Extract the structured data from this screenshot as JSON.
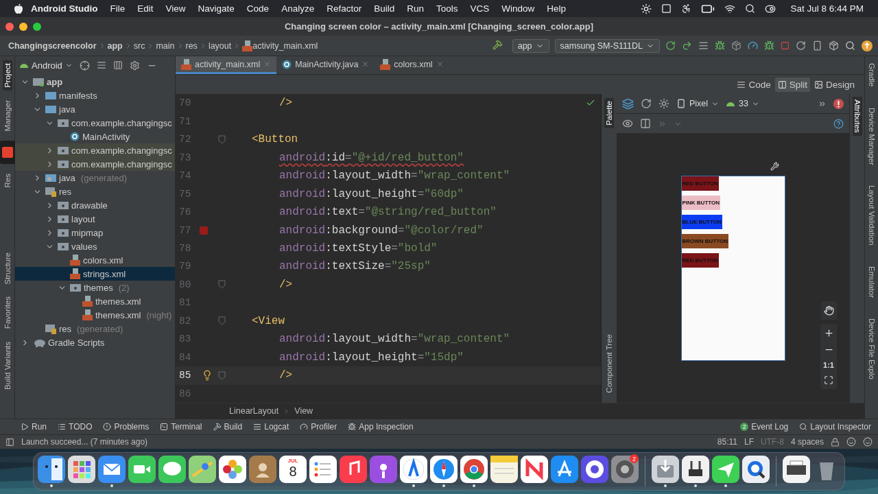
{
  "menu_bar": {
    "app": "Android Studio",
    "menus": [
      "File",
      "Edit",
      "View",
      "Navigate",
      "Code",
      "Analyze",
      "Refactor",
      "Build",
      "Run",
      "Tools",
      "VCS",
      "Window",
      "Help"
    ],
    "clock": "Sat Jul 8  6:44 PM"
  },
  "window": {
    "title": "Changing screen color – activity_main.xml [Changing_screen_color.app]"
  },
  "nav_bar": {
    "breadcrumbs": [
      "Changingscreencolor",
      "app",
      "src",
      "main",
      "res",
      "layout",
      "activity_main.xml"
    ],
    "run_config": "app",
    "device": "samsung SM-S111DL"
  },
  "left_strip": [
    {
      "label": "Project",
      "selected": true
    },
    {
      "label": "Manager",
      "selected": false
    },
    {
      "label": "Res",
      "selected": false
    },
    {
      "label": "Structure",
      "selected": false
    },
    {
      "label": "Favorites",
      "selected": false
    },
    {
      "label": "Build Variants",
      "selected": false
    }
  ],
  "right_strip": [
    {
      "label": "Gradle",
      "selected": false
    },
    {
      "label": "Device Manager",
      "selected": false
    },
    {
      "label": "Layout Validation",
      "selected": false
    },
    {
      "label": "Emulator",
      "selected": false
    },
    {
      "label": "Device File Explo",
      "selected": false
    }
  ],
  "project_panel": {
    "view": "Android",
    "tree": [
      {
        "label": "app",
        "kind": "module",
        "expanded": true,
        "selected": false,
        "children": [
          {
            "label": "manifests",
            "kind": "folder",
            "expanded": false,
            "selected": false
          },
          {
            "label": "java",
            "kind": "folder",
            "expanded": true,
            "selected": false,
            "children": [
              {
                "label": "com.example.changingsc",
                "kind": "package",
                "expanded": true,
                "selected": false,
                "children": [
                  {
                    "label": "MainActivity",
                    "kind": "class",
                    "selected": false
                  }
                ]
              },
              {
                "label": "com.example.changingsc",
                "kind": "test-package",
                "expanded": false,
                "selected": false
              },
              {
                "label": "com.example.changingsc",
                "kind": "test-package",
                "expanded": false,
                "selected": false
              }
            ]
          },
          {
            "label": "java",
            "note": "(generated)",
            "kind": "generated",
            "expanded": false,
            "selected": false
          },
          {
            "label": "res",
            "kind": "resources",
            "expanded": true,
            "selected": false,
            "children": [
              {
                "label": "drawable",
                "kind": "package",
                "expanded": false,
                "selected": false
              },
              {
                "label": "layout",
                "kind": "package",
                "expanded": false,
                "selected": false
              },
              {
                "label": "mipmap",
                "kind": "package",
                "expanded": false,
                "selected": false
              },
              {
                "label": "values",
                "kind": "package",
                "expanded": true,
                "selected": false,
                "children": [
                  {
                    "label": "colors.xml",
                    "kind": "xml",
                    "selected": false
                  },
                  {
                    "label": "strings.xml",
                    "kind": "xml",
                    "selected": true
                  },
                  {
                    "label": "themes",
                    "note": "(2)",
                    "kind": "package",
                    "expanded": true,
                    "selected": false,
                    "children": [
                      {
                        "label": "themes.xml",
                        "kind": "xml",
                        "selected": false
                      },
                      {
                        "label": "themes.xml",
                        "note": "(night)",
                        "kind": "xml",
                        "selected": false
                      }
                    ]
                  }
                ]
              }
            ]
          },
          {
            "label": "res",
            "note": "(generated)",
            "kind": "resources",
            "selected": false
          }
        ]
      },
      {
        "label": "Gradle Scripts",
        "kind": "gradle",
        "expanded": false,
        "selected": false
      }
    ]
  },
  "editor_tabs": [
    {
      "label": "activity_main.xml",
      "kind": "xml",
      "selected": true
    },
    {
      "label": "MainActivity.java",
      "kind": "java",
      "selected": false
    },
    {
      "label": "colors.xml",
      "kind": "xml",
      "selected": false
    }
  ],
  "view_modes": [
    {
      "label": "Code",
      "selected": false
    },
    {
      "label": "Split",
      "selected": true
    },
    {
      "label": "Design",
      "selected": false
    }
  ],
  "code": [
    {
      "number": "70",
      "kind": "close",
      "tokens": [
        {
          "kind": "tag",
          "text": "/>"
        }
      ]
    },
    {
      "number": "71",
      "kind": "blank"
    },
    {
      "number": "72",
      "kind": "open",
      "fold": true,
      "tokens": [
        {
          "kind": "tag",
          "text": "<Button"
        }
      ]
    },
    {
      "number": "73",
      "kind": "attribute",
      "error": true,
      "tokens": [
        {
          "kind": "ns",
          "text": "android"
        },
        {
          "kind": "name",
          "text": ":id"
        },
        {
          "kind": "eq",
          "text": "="
        },
        {
          "kind": "value",
          "text": "\"@+id/red_button\""
        }
      ]
    },
    {
      "number": "74",
      "kind": "attribute",
      "tokens": [
        {
          "kind": "ns",
          "text": "android"
        },
        {
          "kind": "name",
          "text": ":layout_width"
        },
        {
          "kind": "eq",
          "text": "="
        },
        {
          "kind": "value",
          "text": "\"wrap_content\""
        }
      ]
    },
    {
      "number": "75",
      "kind": "attribute",
      "tokens": [
        {
          "kind": "ns",
          "text": "android"
        },
        {
          "kind": "name",
          "text": ":layout_height"
        },
        {
          "kind": "eq",
          "text": "="
        },
        {
          "kind": "value",
          "text": "\"60dp\""
        }
      ]
    },
    {
      "number": "76",
      "kind": "attribute",
      "tokens": [
        {
          "kind": "ns",
          "text": "android"
        },
        {
          "kind": "name",
          "text": ":text"
        },
        {
          "kind": "eq",
          "text": "="
        },
        {
          "kind": "value",
          "text": "\"@string/red_button\""
        }
      ]
    },
    {
      "number": "77",
      "kind": "attribute",
      "breakpoint": true,
      "tokens": [
        {
          "kind": "ns",
          "text": "android"
        },
        {
          "kind": "name",
          "text": ":background"
        },
        {
          "kind": "eq",
          "text": "="
        },
        {
          "kind": "value",
          "text": "\"@color/red\""
        }
      ]
    },
    {
      "number": "78",
      "kind": "attribute",
      "tokens": [
        {
          "kind": "ns",
          "text": "android"
        },
        {
          "kind": "name",
          "text": ":textStyle"
        },
        {
          "kind": "eq",
          "text": "="
        },
        {
          "kind": "value",
          "text": "\"bold\""
        }
      ]
    },
    {
      "number": "79",
      "kind": "attribute",
      "tokens": [
        {
          "kind": "ns",
          "text": "android"
        },
        {
          "kind": "name",
          "text": ":textSize"
        },
        {
          "kind": "eq",
          "text": "="
        },
        {
          "kind": "value",
          "text": "\"25sp\""
        }
      ]
    },
    {
      "number": "80",
      "kind": "close",
      "fold": true,
      "tokens": [
        {
          "kind": "tag",
          "text": "/>"
        }
      ]
    },
    {
      "number": "81",
      "kind": "blank"
    },
    {
      "number": "82",
      "kind": "open",
      "fold": true,
      "tokens": [
        {
          "kind": "tag",
          "text": "<View"
        }
      ]
    },
    {
      "number": "83",
      "kind": "attribute",
      "tokens": [
        {
          "kind": "ns",
          "text": "android"
        },
        {
          "kind": "name",
          "text": ":layout_width"
        },
        {
          "kind": "eq",
          "text": "="
        },
        {
          "kind": "value",
          "text": "\"wrap_content\""
        }
      ]
    },
    {
      "number": "84",
      "kind": "attribute",
      "tokens": [
        {
          "kind": "ns",
          "text": "android"
        },
        {
          "kind": "name",
          "text": ":layout_height"
        },
        {
          "kind": "eq",
          "text": "="
        },
        {
          "kind": "value",
          "text": "\"15dp\""
        }
      ]
    },
    {
      "number": "85",
      "kind": "close",
      "fold": true,
      "current": true,
      "hint": true,
      "tokens": [
        {
          "kind": "tag",
          "text": "/>"
        }
      ]
    },
    {
      "number": "86",
      "kind": "blank"
    }
  ],
  "code_breadcrumbs": [
    "LinearLayout",
    "View"
  ],
  "design": {
    "device": "Pixel",
    "api": "33",
    "side_tabs": [
      {
        "label": "Palette",
        "selected": true
      },
      {
        "label": "Component Tree",
        "selected": false
      },
      {
        "label": "Attributes",
        "selected": true
      }
    ],
    "zoom_reset": "1:1",
    "preview_buttons": [
      {
        "label": "RED BUTTON",
        "color": "#7a1418"
      },
      {
        "label": "PINK BUTTON",
        "color": "#ecbcc4"
      },
      {
        "label": "BLUE BUTTON",
        "color": "#0c3cf2"
      },
      {
        "label": "BROWN BUTTON",
        "color": "#8a4a22"
      },
      {
        "label": "RED BUTTON",
        "color": "#7a1418"
      }
    ]
  },
  "tool_tabs": [
    "Run",
    "TODO",
    "Problems",
    "Terminal",
    "Build",
    "Logcat",
    "Profiler",
    "App Inspection"
  ],
  "tool_tabs_right": [
    {
      "label": "Event Log",
      "badge": "2"
    },
    {
      "label": "Layout Inspector"
    }
  ],
  "status_bar": {
    "message": "Launch succeed... (7 minutes ago)",
    "items": [
      "85:11",
      "LF",
      "UTF-8",
      "4 spaces"
    ]
  },
  "dock": {
    "groups": [
      [
        {
          "running": true
        },
        {
          "running": false
        },
        {
          "running": true
        },
        {
          "running": false
        },
        {
          "running": false
        },
        {
          "running": false
        },
        {
          "running": false
        },
        {
          "running": false
        },
        {
          "running": false,
          "month": "JUL",
          "day": "8"
        },
        {
          "running": false
        },
        {
          "running": false
        },
        {
          "running": false
        },
        {
          "running": true
        },
        {
          "running": true
        },
        {
          "running": true
        },
        {
          "running": false
        },
        {
          "running": false
        },
        {
          "running": false
        },
        {
          "running": false
        },
        {
          "running": false,
          "badge": "2"
        }
      ],
      [
        {
          "running": true
        },
        {
          "running": true
        },
        {
          "running": true
        },
        {
          "running": false
        }
      ],
      [
        {
          "running": false
        },
        {
          "running": false
        }
      ]
    ]
  }
}
